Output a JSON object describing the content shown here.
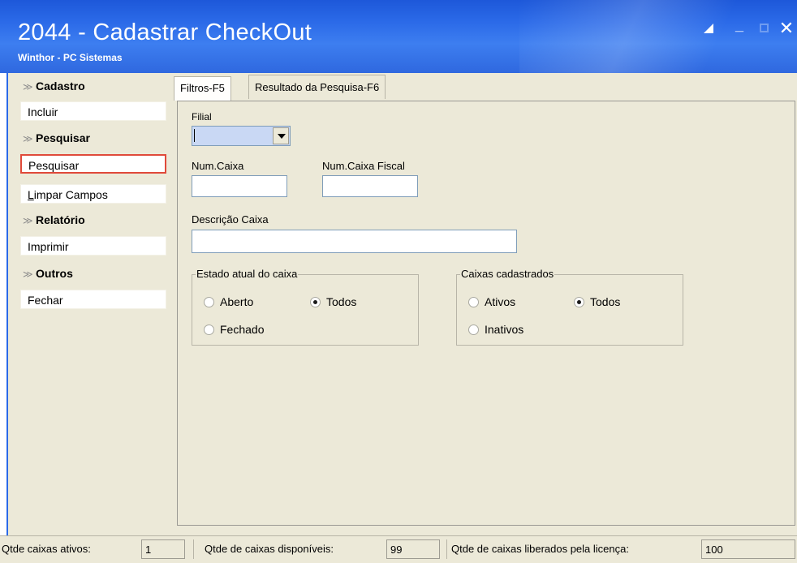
{
  "window": {
    "title": "2044 - Cadastrar CheckOut",
    "subtitle": "Winthor - PC Sistemas"
  },
  "sidebar": {
    "sections": [
      {
        "label": "Cadastro",
        "items": [
          {
            "label": "Incluir"
          }
        ]
      },
      {
        "label": "Pesquisar",
        "items": [
          {
            "label": "Pesquisar",
            "selected": true
          },
          {
            "label_underlined": "L",
            "label_rest": "impar Campos"
          }
        ]
      },
      {
        "label": "Relatório",
        "items": [
          {
            "label": "Imprimir"
          }
        ]
      },
      {
        "label": "Outros",
        "items": [
          {
            "label": "Fechar"
          }
        ]
      }
    ]
  },
  "tabs": [
    {
      "label": "Filtros-F5",
      "active": true
    },
    {
      "label": "Resultado da Pesquisa-F6",
      "active": false
    }
  ],
  "filters": {
    "filial_label": "Filial",
    "filial_value": "",
    "num_caixa_label": "Num.Caixa",
    "num_caixa_value": "",
    "num_caixa_fiscal_label": "Num.Caixa Fiscal",
    "num_caixa_fiscal_value": "",
    "descricao_label": "Descrição Caixa",
    "descricao_value": ""
  },
  "estado_group": {
    "legend": "Estado atual do caixa",
    "options": [
      "Aberto",
      "Todos",
      "Fechado"
    ],
    "selected": "Todos"
  },
  "cadastrados_group": {
    "legend": "Caixas cadastrados",
    "options": [
      "Ativos",
      "Todos",
      "Inativos"
    ],
    "selected": "Todos"
  },
  "status": {
    "ativos_label": "Qtde caixas ativos:",
    "ativos_value": "1",
    "disponiveis_label": "Qtde de caixas disponíveis:",
    "disponiveis_value": "99",
    "liberados_label": "Qtde de caixas liberados pela licença:",
    "liberados_value": "100"
  },
  "colors": {
    "titlebar": "#2b6ae8",
    "selection_border": "#e04a3a",
    "panel_bg": "#ece9d8"
  }
}
